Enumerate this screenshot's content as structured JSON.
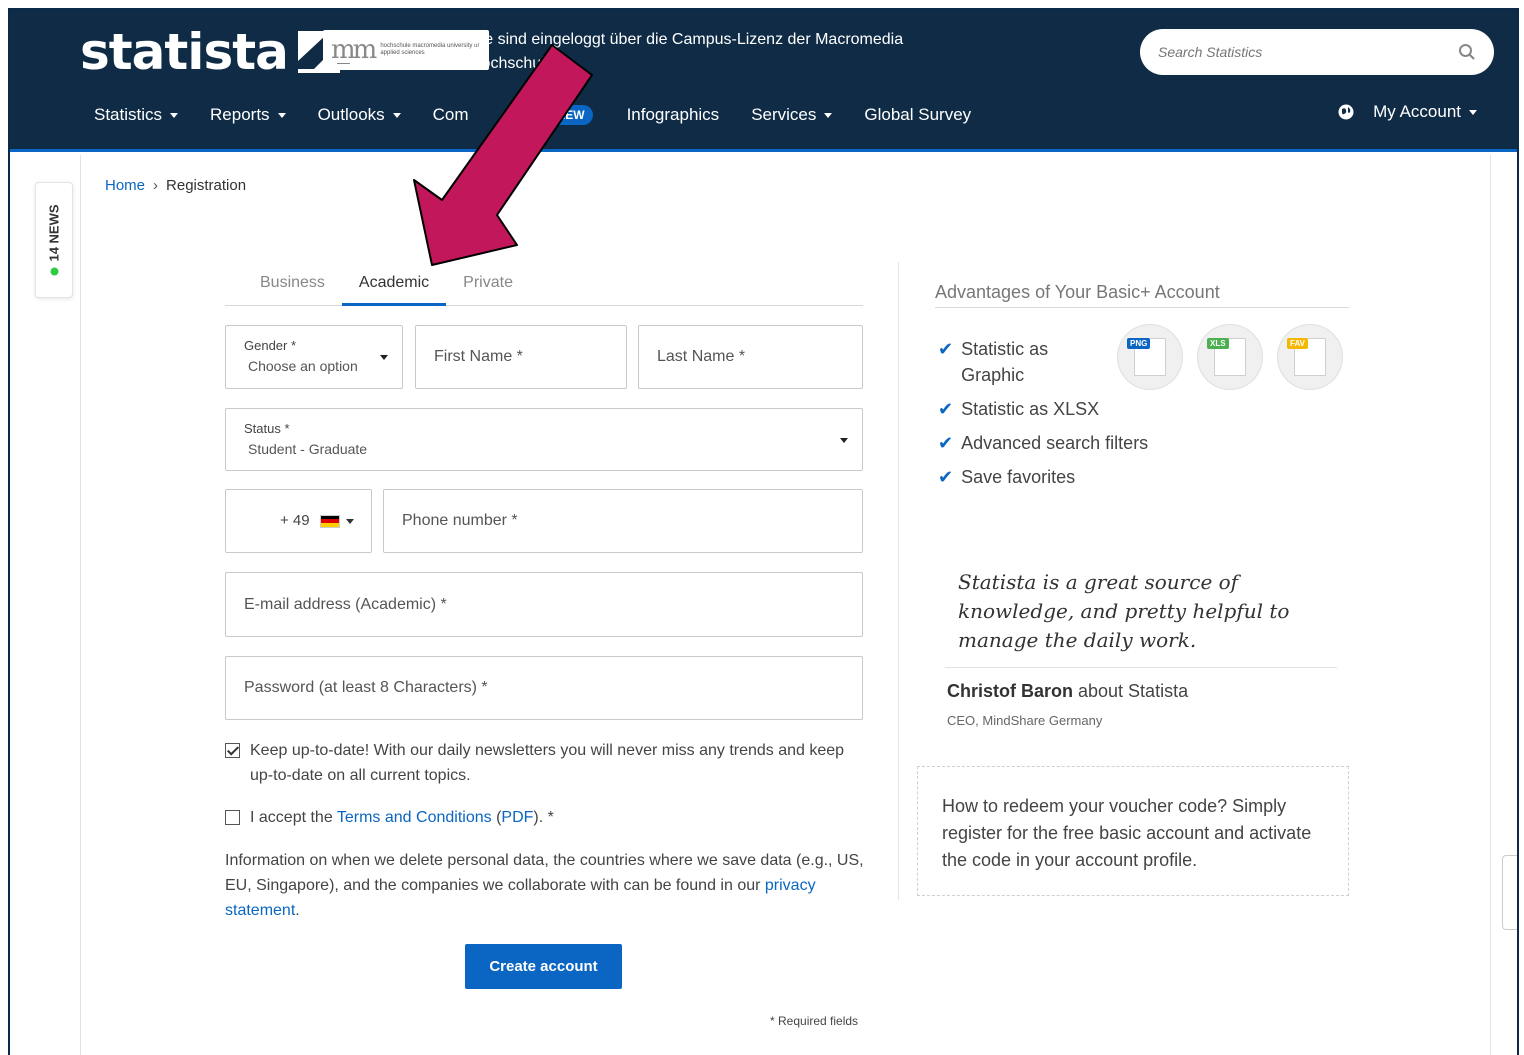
{
  "header": {
    "logo_text": "statista",
    "login_note": "Sie sind eingeloggt über die Campus-Lizenz der Macromedia Hochschule",
    "partner_logo_text": "hochschule macromedia university of applied sciences",
    "search_placeholder": "Search Statistics",
    "nav": [
      {
        "label": "Statistics",
        "has_dropdown": true
      },
      {
        "label": "Reports",
        "has_dropdown": true
      },
      {
        "label": "Outlooks",
        "has_dropdown": true
      },
      {
        "label": "Com",
        "has_dropdown": false
      },
      {
        "label": "Infographics",
        "has_dropdown": false
      },
      {
        "label": "Services",
        "has_dropdown": true
      },
      {
        "label": "Global Survey",
        "has_dropdown": false
      }
    ],
    "new_badge": "NEW",
    "account_label": "My Account"
  },
  "news_tab": {
    "label": "14 NEWS"
  },
  "breadcrumb": {
    "home": "Home",
    "separator": "›",
    "current": "Registration"
  },
  "tabs": [
    {
      "label": "Business",
      "active": false
    },
    {
      "label": "Academic",
      "active": true
    },
    {
      "label": "Private",
      "active": false
    }
  ],
  "form": {
    "gender_label": "Gender *",
    "gender_value": "Choose an option",
    "first_name": "First Name *",
    "last_name": "Last Name *",
    "status_label": "Status *",
    "status_value": "Student - Graduate",
    "phone_code": "+ 49",
    "phone_placeholder": "Phone number *",
    "email_placeholder": "E-mail address (Academic) *",
    "password_placeholder": "Password (at least 8 Characters) *",
    "newsletter_text": "Keep up-to-date! With our daily newsletters you will never miss any trends and keep up-to-date on all current topics.",
    "newsletter_checked": true,
    "terms_prefix": "I accept the ",
    "terms_link": "Terms and Conditions",
    "terms_mid": " (",
    "terms_pdf": "PDF",
    "terms_suffix": "). *",
    "terms_checked": false,
    "privacy_text": "Information on when we delete personal data, the countries where we save data (e.g., US, EU, Singapore), and the companies we collaborate with can be found in our ",
    "privacy_link": "privacy statement",
    "privacy_end": ".",
    "submit_label": "Create account",
    "required_note": "* Required fields"
  },
  "advantages": {
    "title": "Advantages of Your Basic+ Account",
    "items": [
      "Statistic as Graphic",
      "Statistic as XLSX",
      "Advanced search filters",
      "Save favorites"
    ],
    "badges": [
      {
        "label": "PNG",
        "color": "#0a66c2"
      },
      {
        "label": "XLS",
        "color": "#4caf50"
      },
      {
        "label": "FAV",
        "color": "#f5b800"
      }
    ]
  },
  "testimonial": {
    "quote": "Statista is a great source of knowledge, and pretty helpful to manage the daily work.",
    "author": "Christof Baron",
    "author_suffix": " about Statista",
    "role": "CEO, MindShare Germany"
  },
  "voucher": {
    "text": "How to redeem your voucher code? Simply register for the free basic account and activate the code in your account profile."
  },
  "colors": {
    "header_bg": "#0f2b46",
    "accent": "#0a66c2",
    "annotation_arrow": "#c2185b"
  }
}
